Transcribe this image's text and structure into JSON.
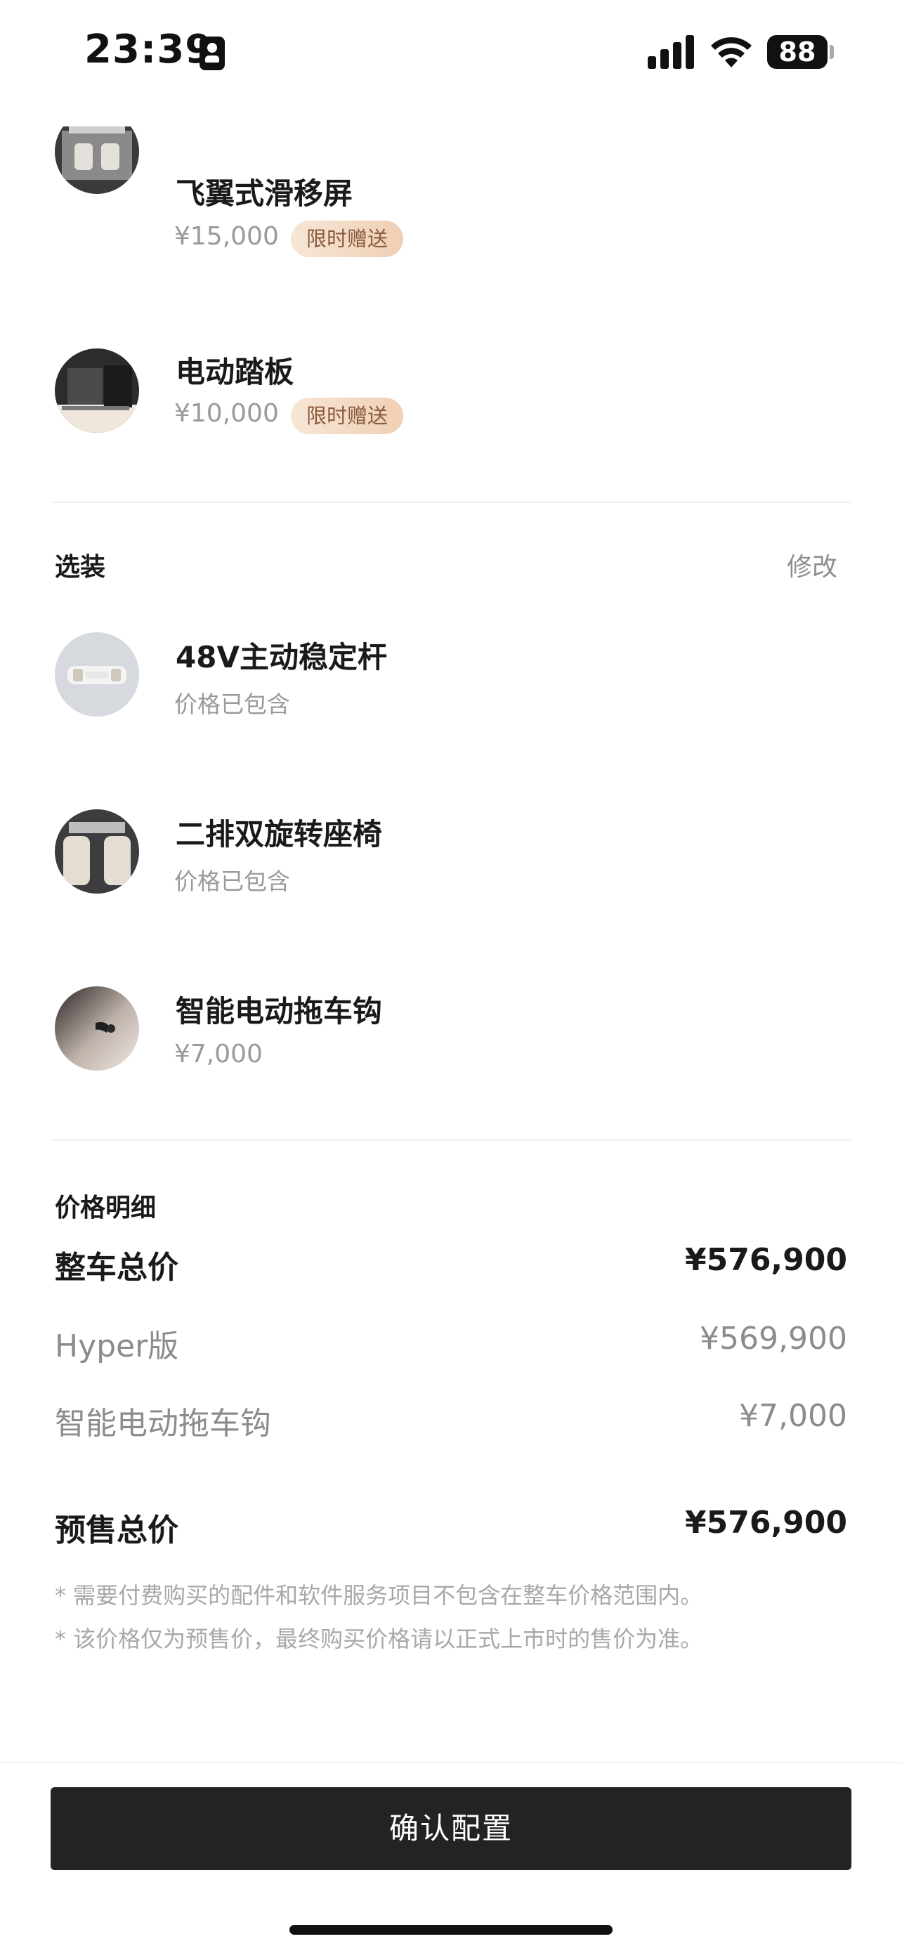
{
  "status_bar": {
    "time": "23:39",
    "battery": "88"
  },
  "packages": [
    {
      "title": "飞翼式滑移屏",
      "price": "¥15,000",
      "tag": "限时赠送"
    },
    {
      "title": "电动踏板",
      "price": "¥10,000",
      "tag": "限时赠送"
    }
  ],
  "options_section": {
    "label": "选装",
    "edit": "修改"
  },
  "options": [
    {
      "title": "48V主动稳定杆",
      "price": "价格已包含"
    },
    {
      "title": "二排双旋转座椅",
      "price": "价格已包含"
    },
    {
      "title": "智能电动拖车钩",
      "price": "¥7,000"
    }
  ],
  "price_detail": {
    "label": "价格明细",
    "total_label": "整车总价",
    "total_value": "¥576,900",
    "lines": [
      {
        "label": "Hyper版",
        "value": "¥569,900"
      },
      {
        "label": "智能电动拖车钩",
        "value": "¥7,000"
      }
    ],
    "presale_label": "预售总价",
    "presale_value": "¥576,900"
  },
  "notes": [
    "* 需要付费购买的配件和软件服务项目不包含在整车价格范围内。",
    "* 该价格仅为预售价，最终购买价格请以正式上市时的售价为准。"
  ],
  "confirm_button": "确认配置",
  "icons": {
    "back": "chevron-left-icon",
    "signal": "cellular-signal-icon",
    "wifi": "wifi-icon",
    "badge": "id-badge-icon"
  }
}
